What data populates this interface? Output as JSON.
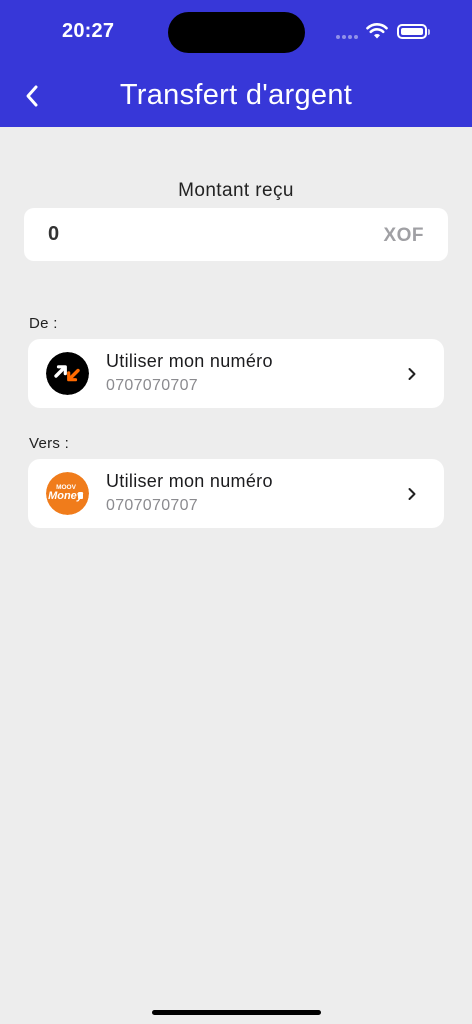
{
  "status": {
    "time": "20:27"
  },
  "header": {
    "title": "Transfert d'argent"
  },
  "amount": {
    "label": "Montant reçu",
    "value": "0",
    "currency": "XOF"
  },
  "from": {
    "label": "De :",
    "title": "Utiliser mon numéro",
    "number": "0707070707",
    "logo": "orange-money-logo"
  },
  "to": {
    "label": "Vers :",
    "title": "Utiliser mon numéro",
    "number": "0707070707",
    "logo": "moov-money-logo",
    "logo_text_top": "MOOV",
    "logo_text_main": "Money"
  },
  "colors": {
    "header": "#3737d8",
    "background": "#ededed",
    "orange": "#ff6a00",
    "moov_orange": "#f07c1b"
  }
}
